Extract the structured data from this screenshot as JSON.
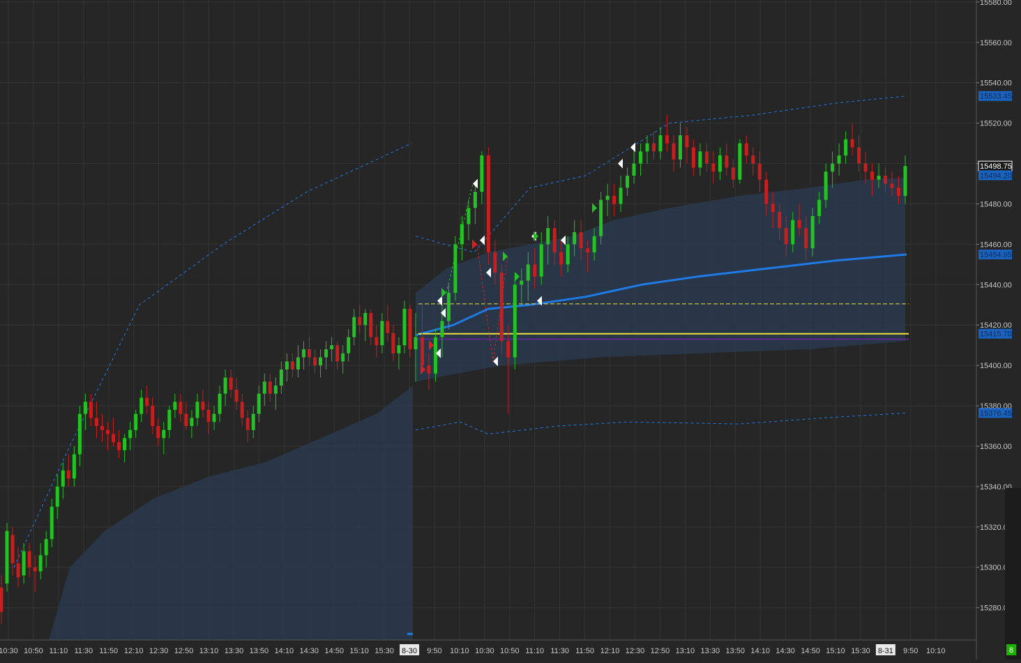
{
  "colors": {
    "background": "#262626",
    "grid": "#353535",
    "up_candle": "#22c322",
    "down_candle": "#c81e1e",
    "volume_profile_fill": "#2a3a4e",
    "vwap": "#1e7be8",
    "band": "#1e7be8",
    "level_yellow": "#f0e040",
    "level_purple": "#5a2a8a",
    "axis_text": "#c8c8c8",
    "price_tag_blue": "#1a64c0",
    "indicator_green": "#1db100"
  },
  "chart_data": {
    "type": "candlestick",
    "title": "",
    "ylim": [
      15264,
      15581
    ],
    "y_ticks": [
      15580,
      15560,
      15540,
      15520,
      15500,
      15480,
      15460,
      15440,
      15420,
      15400,
      15380,
      15360,
      15340,
      15320,
      15300,
      15280
    ],
    "y_tick_labels": [
      "15580.00",
      "15560.00",
      "15540.00",
      "15520.00",
      "15500.00",
      "15480.00",
      "15460.00",
      "15440.00",
      "15420.00",
      "15400.00",
      "15380.00",
      "15360.00",
      "15340.00",
      "15320.00",
      "15300.00",
      "15280.00"
    ],
    "x_tick_labels": [
      "10:30",
      "10:50",
      "11:10",
      "11:30",
      "11:50",
      "12:10",
      "12:30",
      "12:50",
      "13:10",
      "13:30",
      "13:50",
      "14:10",
      "14:30",
      "14:50",
      "15:10",
      "15:30",
      "8-30",
      "9:50",
      "10:10",
      "10:30",
      "10:50",
      "11:10",
      "11:30",
      "11:50",
      "12:10",
      "12:30",
      "12:50",
      "13:10",
      "13:30",
      "13:50",
      "14:10",
      "14:30",
      "14:50",
      "15:10",
      "15:30",
      "8-31",
      "9:50",
      "10:10"
    ],
    "session_break_labels": [
      "8-30",
      "8-31"
    ],
    "price_tags": [
      {
        "label": "15533.45",
        "value": 15533.45,
        "style": "blue"
      },
      {
        "label": "15498.75",
        "value": 15498.75,
        "style": "white"
      },
      {
        "label": "15494.20",
        "value": 15494.2,
        "style": "blue"
      },
      {
        "label": "15454.95",
        "value": 15454.95,
        "style": "blue"
      },
      {
        "label": "15415.70",
        "value": 15415.7,
        "style": "blue"
      },
      {
        "label": "15376.45",
        "value": 15376.45,
        "style": "blue"
      }
    ],
    "horizontal_levels": [
      {
        "value": 15415.7,
        "color": "#f0e040",
        "style": "solid"
      },
      {
        "value": 15430.5,
        "color": "#f0e040",
        "style": "dashed"
      },
      {
        "value": 15413,
        "color": "#5a2a8a",
        "style": "solid"
      }
    ],
    "candles_day1": [
      [
        15290,
        15296,
        15272,
        15278
      ],
      [
        15292,
        15322,
        15288,
        15318
      ],
      [
        15316,
        15320,
        15296,
        15302
      ],
      [
        15302,
        15310,
        15290,
        15295
      ],
      [
        15296,
        15312,
        15292,
        15308
      ],
      [
        15308,
        15312,
        15295,
        15300
      ],
      [
        15300,
        15306,
        15288,
        15298
      ],
      [
        15298,
        15312,
        15294,
        15306
      ],
      [
        15306,
        15318,
        15300,
        15314
      ],
      [
        15314,
        15334,
        15310,
        15330
      ],
      [
        15330,
        15346,
        15324,
        15340
      ],
      [
        15340,
        15352,
        15334,
        15348
      ],
      [
        15348,
        15356,
        15340,
        15344
      ],
      [
        15344,
        15360,
        15340,
        15356
      ],
      [
        15356,
        15380,
        15350,
        15376
      ],
      [
        15376,
        15386,
        15368,
        15382
      ],
      [
        15382,
        15386,
        15370,
        15374
      ],
      [
        15374,
        15382,
        15364,
        15370
      ],
      [
        15370,
        15376,
        15362,
        15368
      ],
      [
        15368,
        15372,
        15358,
        15366
      ],
      [
        15366,
        15374,
        15360,
        15362
      ],
      [
        15362,
        15368,
        15354,
        15358
      ],
      [
        15358,
        15366,
        15352,
        15364
      ],
      [
        15364,
        15372,
        15358,
        15368
      ],
      [
        15368,
        15378,
        15364,
        15376
      ],
      [
        15376,
        15388,
        15372,
        15384
      ],
      [
        15384,
        15390,
        15376,
        15380
      ],
      [
        15380,
        15384,
        15366,
        15370
      ],
      [
        15370,
        15374,
        15360,
        15364
      ],
      [
        15364,
        15372,
        15356,
        15368
      ],
      [
        15368,
        15380,
        15364,
        15378
      ],
      [
        15378,
        15386,
        15374,
        15382
      ],
      [
        15382,
        15386,
        15372,
        15376
      ],
      [
        15376,
        15382,
        15368,
        15370
      ],
      [
        15370,
        15378,
        15364,
        15374
      ],
      [
        15374,
        15386,
        15370,
        15382
      ],
      [
        15382,
        15388,
        15374,
        15378
      ],
      [
        15378,
        15382,
        15366,
        15372
      ],
      [
        15372,
        15380,
        15368,
        15376
      ],
      [
        15376,
        15390,
        15372,
        15386
      ],
      [
        15386,
        15398,
        15380,
        15394
      ],
      [
        15394,
        15398,
        15384,
        15388
      ],
      [
        15388,
        15394,
        15378,
        15382
      ],
      [
        15382,
        15386,
        15370,
        15374
      ],
      [
        15374,
        15378,
        15362,
        15368
      ],
      [
        15368,
        15380,
        15364,
        15376
      ],
      [
        15376,
        15390,
        15372,
        15386
      ],
      [
        15386,
        15396,
        15380,
        15392
      ],
      [
        15392,
        15396,
        15382,
        15386
      ],
      [
        15386,
        15394,
        15378,
        15390
      ],
      [
        15390,
        15402,
        15386,
        15398
      ],
      [
        15398,
        15406,
        15392,
        15402
      ],
      [
        15402,
        15406,
        15394,
        15398
      ],
      [
        15398,
        15410,
        15394,
        15404
      ],
      [
        15404,
        15412,
        15398,
        15408
      ],
      [
        15408,
        15414,
        15400,
        15404
      ],
      [
        15404,
        15408,
        15396,
        15400
      ],
      [
        15400,
        15408,
        15394,
        15404
      ],
      [
        15404,
        15412,
        15398,
        15408
      ],
      [
        15408,
        15414,
        15402,
        15410
      ],
      [
        15410,
        15412,
        15398,
        15402
      ],
      [
        15402,
        15410,
        15396,
        15406
      ],
      [
        15406,
        15418,
        15402,
        15414
      ],
      [
        15414,
        15428,
        15410,
        15424
      ],
      [
        15424,
        15430,
        15416,
        15420
      ],
      [
        15420,
        15428,
        15412,
        15426
      ],
      [
        15426,
        15428,
        15410,
        15414
      ],
      [
        15414,
        15420,
        15404,
        15410
      ],
      [
        15410,
        15426,
        15406,
        15422
      ],
      [
        15422,
        15430,
        15412,
        15416
      ],
      [
        15416,
        15420,
        15402,
        15406
      ],
      [
        15406,
        15414,
        15398,
        15410
      ],
      [
        15410,
        15432,
        15406,
        15428
      ],
      [
        15428,
        15430,
        15404,
        15408
      ]
    ],
    "candles_day2": [
      [
        15408,
        15426,
        15392,
        15414
      ],
      [
        15414,
        15430,
        15396,
        15400
      ],
      [
        15400,
        15406,
        15388,
        15396
      ],
      [
        15396,
        15418,
        15392,
        15414
      ],
      [
        15414,
        15430,
        15404,
        15422
      ],
      [
        15422,
        15440,
        15418,
        15436
      ],
      [
        15436,
        15464,
        15432,
        15460
      ],
      [
        15460,
        15474,
        15452,
        15470
      ],
      [
        15470,
        15482,
        15462,
        15478
      ],
      [
        15478,
        15490,
        15470,
        15486
      ],
      [
        15486,
        15506,
        15480,
        15504
      ],
      [
        15504,
        15508,
        15450,
        15456
      ],
      [
        15456,
        15462,
        15440,
        15446
      ],
      [
        15446,
        15450,
        15405,
        15412
      ],
      [
        15412,
        15420,
        15376,
        15404
      ],
      [
        15404,
        15445,
        15398,
        15440
      ],
      [
        15440,
        15448,
        15430,
        15442
      ],
      [
        15442,
        15456,
        15432,
        15450
      ],
      [
        15450,
        15458,
        15438,
        15444
      ],
      [
        15444,
        15466,
        15440,
        15460
      ],
      [
        15460,
        15474,
        15450,
        15468
      ],
      [
        15468,
        15472,
        15450,
        15456
      ],
      [
        15456,
        15462,
        15444,
        15450
      ],
      [
        15450,
        15464,
        15446,
        15460
      ],
      [
        15460,
        15472,
        15454,
        15466
      ],
      [
        15466,
        15472,
        15452,
        15458
      ],
      [
        15458,
        15462,
        15446,
        15456
      ],
      [
        15456,
        15468,
        15452,
        15464
      ],
      [
        15464,
        15486,
        15460,
        15482
      ],
      [
        15482,
        15490,
        15474,
        15484
      ],
      [
        15484,
        15490,
        15474,
        15480
      ],
      [
        15480,
        15494,
        15476,
        15488
      ],
      [
        15488,
        15498,
        15484,
        15494
      ],
      [
        15494,
        15506,
        15490,
        15500
      ],
      [
        15500,
        15510,
        15494,
        15506
      ],
      [
        15506,
        15514,
        15500,
        15510
      ],
      [
        15510,
        15516,
        15502,
        15506
      ],
      [
        15506,
        15518,
        15502,
        15514
      ],
      [
        15514,
        15524,
        15506,
        15510
      ],
      [
        15510,
        15514,
        15496,
        15502
      ],
      [
        15502,
        15520,
        15498,
        15514
      ],
      [
        15514,
        15518,
        15500,
        15508
      ],
      [
        15508,
        15512,
        15494,
        15498
      ],
      [
        15498,
        15510,
        15494,
        15506
      ],
      [
        15506,
        15510,
        15496,
        15500
      ],
      [
        15500,
        15506,
        15490,
        15496
      ],
      [
        15496,
        15508,
        15492,
        15504
      ],
      [
        15504,
        15510,
        15494,
        15498
      ],
      [
        15498,
        15502,
        15488,
        15492
      ],
      [
        15492,
        15512,
        15490,
        15510
      ],
      [
        15510,
        15514,
        15500,
        15504
      ],
      [
        15504,
        15508,
        15494,
        15500
      ],
      [
        15500,
        15506,
        15486,
        15492
      ],
      [
        15492,
        15496,
        15474,
        15480
      ],
      [
        15480,
        15486,
        15468,
        15476
      ],
      [
        15476,
        15480,
        15462,
        15468
      ],
      [
        15468,
        15474,
        15454,
        15460
      ],
      [
        15460,
        15476,
        15456,
        15472
      ],
      [
        15472,
        15480,
        15464,
        15468
      ],
      [
        15468,
        15474,
        15452,
        15458
      ],
      [
        15458,
        15478,
        15454,
        15474
      ],
      [
        15474,
        15486,
        15470,
        15482
      ],
      [
        15482,
        15500,
        15478,
        15496
      ],
      [
        15496,
        15506,
        15488,
        15500
      ],
      [
        15500,
        15510,
        15494,
        15504
      ],
      [
        15504,
        15516,
        15500,
        15512
      ],
      [
        15512,
        15520,
        15504,
        15508
      ],
      [
        15508,
        15514,
        15496,
        15500
      ],
      [
        15500,
        15506,
        15490,
        15496
      ],
      [
        15496,
        15500,
        15484,
        15492
      ],
      [
        15492,
        15500,
        15488,
        15494
      ],
      [
        15494,
        15498,
        15486,
        15490
      ],
      [
        15490,
        15496,
        15484,
        15488
      ],
      [
        15488,
        15494,
        15480,
        15484
      ],
      [
        15484,
        15504,
        15480,
        15498.75
      ]
    ]
  },
  "indicator": {
    "badge_label": "8"
  }
}
